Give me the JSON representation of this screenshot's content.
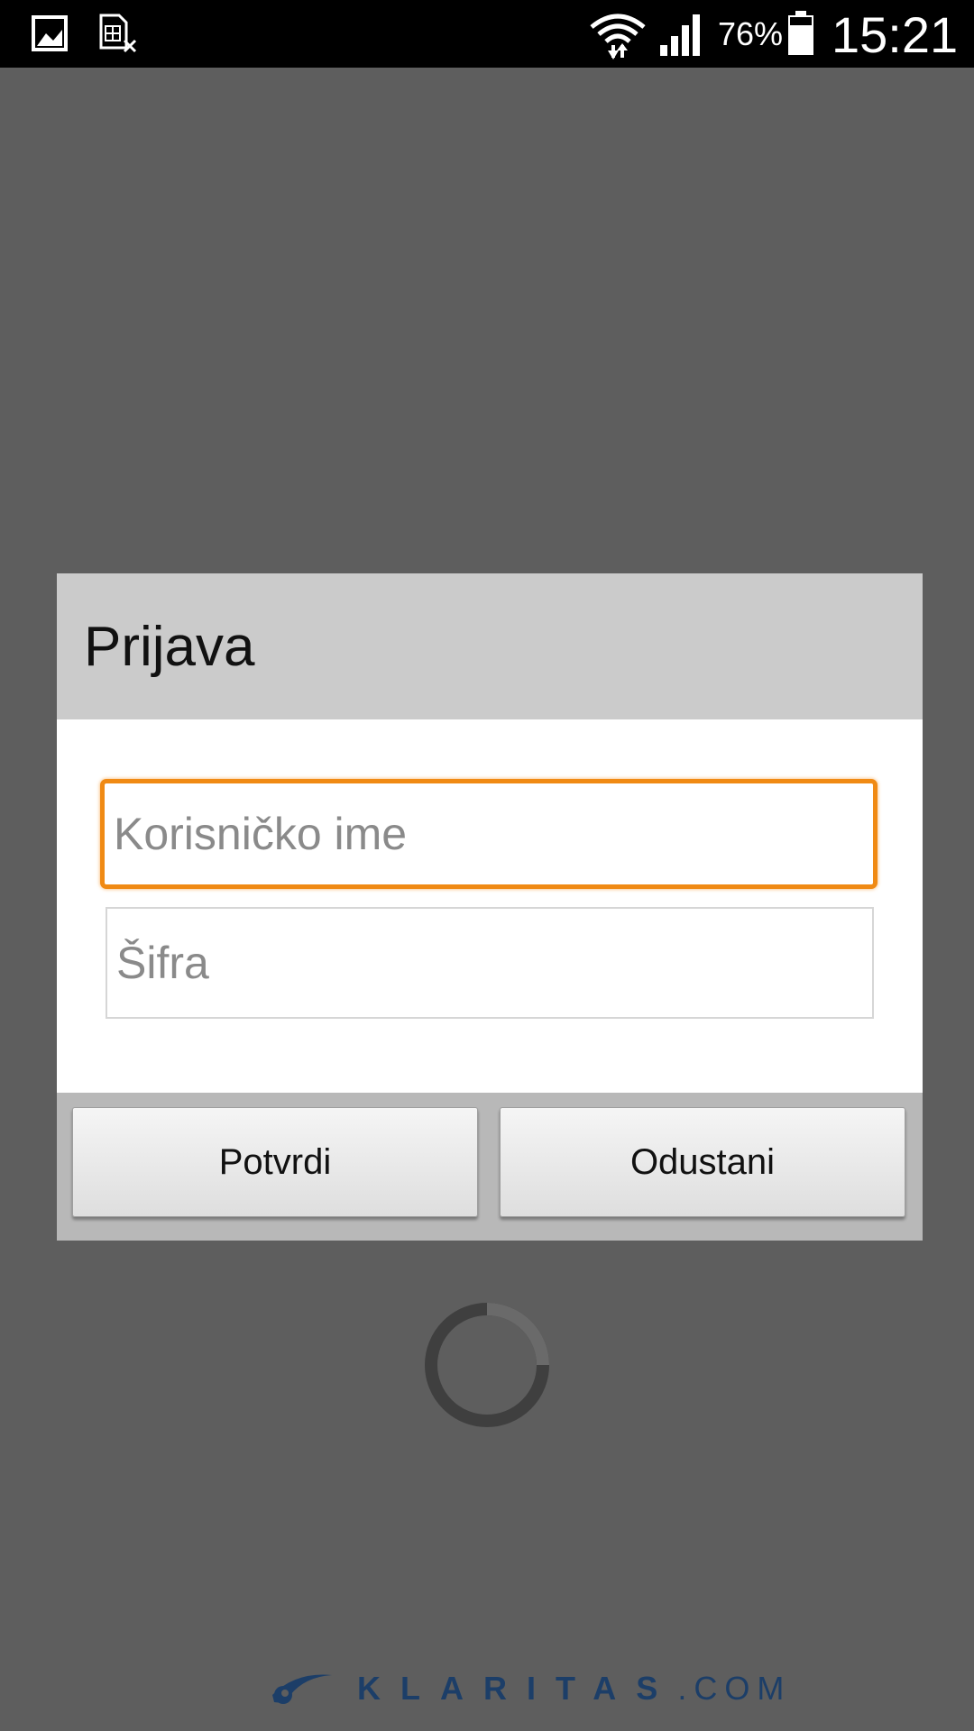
{
  "status_bar": {
    "battery_percent": "76%",
    "time": "15:21",
    "icons": [
      "gallery-icon",
      "sim-card-missing-icon",
      "wifi-icon",
      "signal-icon",
      "battery-icon"
    ]
  },
  "dialog": {
    "title": "Prijava",
    "username_placeholder": "Korisničko ime",
    "password_placeholder": "Šifra",
    "confirm_label": "Potvrdi",
    "cancel_label": "Odustani"
  },
  "footer": {
    "brand": "KLARITAS",
    "suffix": ".COM"
  },
  "colors": {
    "focus_border": "#f08a14",
    "brand": "#1c3e68",
    "overlay": "#5e5e5e"
  }
}
